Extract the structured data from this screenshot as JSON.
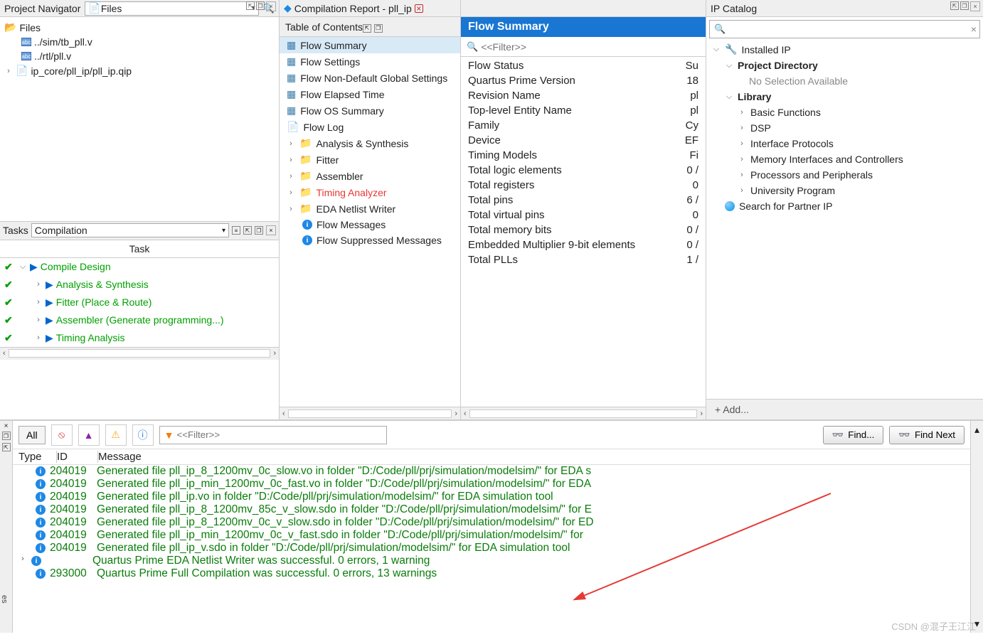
{
  "projectNavigator": {
    "title": "Project Navigator",
    "combo": "Files",
    "rootFolder": "Files",
    "files": [
      "../sim/tb_pll.v",
      "../rtl/pll.v"
    ],
    "qip": "ip_core/pll_ip/pll_ip.qip"
  },
  "tasks": {
    "title": "Tasks",
    "combo": "Compilation",
    "columnHeader": "Task",
    "items": [
      "Compile Design",
      "Analysis & Synthesis",
      "Fitter (Place & Route)",
      "Assembler (Generate programming...)",
      "Timing Analysis"
    ]
  },
  "compReport": {
    "tabTitle": "Compilation Report - pll_ip",
    "tocTitle": "Table of Contents",
    "toc": [
      {
        "icon": "grid",
        "label": "Flow Summary",
        "selected": true
      },
      {
        "icon": "grid",
        "label": "Flow Settings"
      },
      {
        "icon": "grid",
        "label": "Flow Non-Default Global Settings"
      },
      {
        "icon": "grid",
        "label": "Flow Elapsed Time"
      },
      {
        "icon": "grid",
        "label": "Flow OS Summary"
      },
      {
        "icon": "doc",
        "label": "Flow Log"
      },
      {
        "icon": "folder",
        "label": "Analysis & Synthesis",
        "expand": true
      },
      {
        "icon": "folder",
        "label": "Fitter",
        "expand": true
      },
      {
        "icon": "folder",
        "label": "Assembler",
        "expand": true
      },
      {
        "icon": "folder",
        "label": "Timing Analyzer",
        "expand": true,
        "red": true
      },
      {
        "icon": "folder",
        "label": "EDA Netlist Writer",
        "expand": true
      },
      {
        "icon": "info",
        "label": "Flow Messages",
        "indent": true
      },
      {
        "icon": "info",
        "label": "Flow Suppressed Messages",
        "indent": true
      }
    ]
  },
  "flowSummary": {
    "title": "Flow Summary",
    "filterPlaceholder": "<<Filter>>",
    "rows": [
      {
        "k": "Flow Status",
        "v": "Su"
      },
      {
        "k": "Quartus Prime Version",
        "v": "18"
      },
      {
        "k": "Revision Name",
        "v": "pl"
      },
      {
        "k": "Top-level Entity Name",
        "v": "pl"
      },
      {
        "k": "Family",
        "v": "Cy"
      },
      {
        "k": "Device",
        "v": "EF"
      },
      {
        "k": "Timing Models",
        "v": "Fi"
      },
      {
        "k": "Total logic elements",
        "v": "0 /"
      },
      {
        "k": "Total registers",
        "v": "0"
      },
      {
        "k": "Total pins",
        "v": "6 /"
      },
      {
        "k": "Total virtual pins",
        "v": "0"
      },
      {
        "k": "Total memory bits",
        "v": "0 /"
      },
      {
        "k": "Embedded Multiplier 9-bit elements",
        "v": "0 /"
      },
      {
        "k": "Total PLLs",
        "v": "1 /"
      }
    ]
  },
  "ipCatalog": {
    "title": "IP Catalog",
    "installed": "Installed IP",
    "projDir": "Project Directory",
    "noSelection": "No Selection Available",
    "library": "Library",
    "categories": [
      "Basic Functions",
      "DSP",
      "Interface Protocols",
      "Memory Interfaces and Controllers",
      "Processors and Peripherals",
      "University Program"
    ],
    "search": "Search for Partner IP",
    "add": "+   Add..."
  },
  "messages": {
    "allLabel": "All",
    "filterPlaceholder": "<<Filter>>",
    "findLabel": "Find...",
    "findNextLabel": "Find Next",
    "cols": [
      "Type",
      "ID",
      "Message"
    ],
    "rows": [
      {
        "id": "204019",
        "txt": "Generated file pll_ip_8_1200mv_0c_slow.vo in folder \"D:/Code/pll/prj/simulation/modelsim/\" for EDA s"
      },
      {
        "id": "204019",
        "txt": "Generated file pll_ip_min_1200mv_0c_fast.vo in folder \"D:/Code/pll/prj/simulation/modelsim/\" for EDA"
      },
      {
        "id": "204019",
        "txt": "Generated file pll_ip.vo in folder \"D:/Code/pll/prj/simulation/modelsim/\" for EDA simulation tool"
      },
      {
        "id": "204019",
        "txt": "Generated file pll_ip_8_1200mv_85c_v_slow.sdo in folder \"D:/Code/pll/prj/simulation/modelsim/\" for E"
      },
      {
        "id": "204019",
        "txt": "Generated file pll_ip_8_1200mv_0c_v_slow.sdo in folder \"D:/Code/pll/prj/simulation/modelsim/\" for ED"
      },
      {
        "id": "204019",
        "txt": "Generated file pll_ip_min_1200mv_0c_v_fast.sdo in folder \"D:/Code/pll/prj/simulation/modelsim/\" for"
      },
      {
        "id": "204019",
        "txt": "Generated file pll_ip_v.sdo in folder \"D:/Code/pll/prj/simulation/modelsim/\" for EDA simulation tool"
      },
      {
        "id": "",
        "txt": "Quartus Prime EDA Netlist Writer was successful. 0 errors, 1 warning",
        "expand": true
      },
      {
        "id": "293000",
        "txt": "Quartus Prime Full Compilation was successful. 0 errors, 13 warnings"
      }
    ]
  },
  "watermark": "CSDN @混子王江江"
}
